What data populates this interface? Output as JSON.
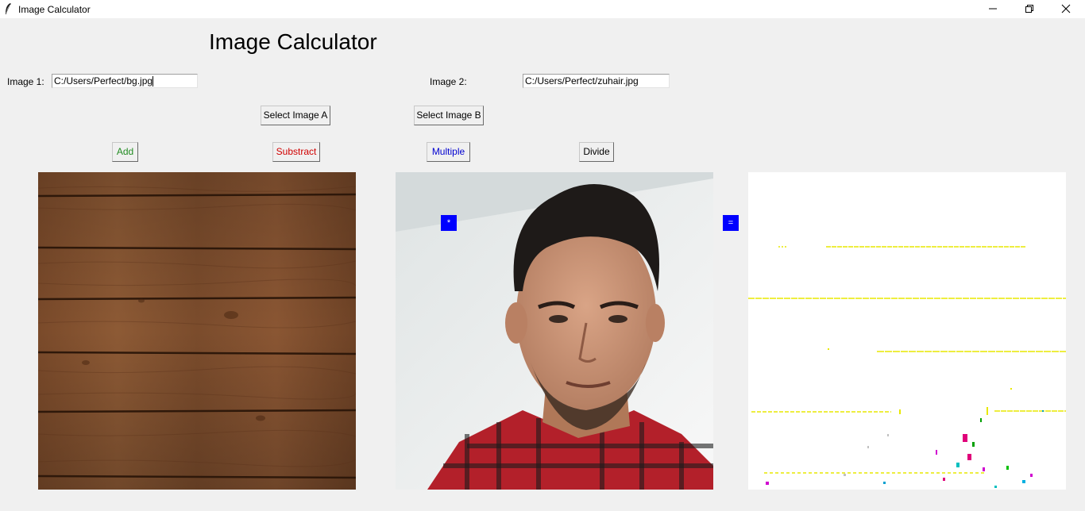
{
  "window": {
    "title": "Image Calculator",
    "icon": "feather-icon",
    "controls": {
      "minimize": "minimize-icon",
      "restore": "restore-icon",
      "close": "close-icon"
    }
  },
  "heading": "Image Calculator",
  "image1": {
    "label": "Image 1:",
    "path": "C:/Users/Perfect/bg.jpg"
  },
  "image2": {
    "label": "Image 2:",
    "path": "C:/Users/Perfect/zuhair.jpg"
  },
  "buttons": {
    "select_a": "Select Image A",
    "select_b": "Select Image B",
    "add": "Add",
    "subtract": "Substract",
    "multiply": "Multiple",
    "divide": "Divide"
  },
  "operators": {
    "current_op": "*",
    "equals": "="
  },
  "colors": {
    "add_text": "#228b22",
    "subtract_text": "#d00000",
    "multiply_text": "#0000d0",
    "operator_bg": "#0000ff",
    "background": "#f0f0f0"
  }
}
